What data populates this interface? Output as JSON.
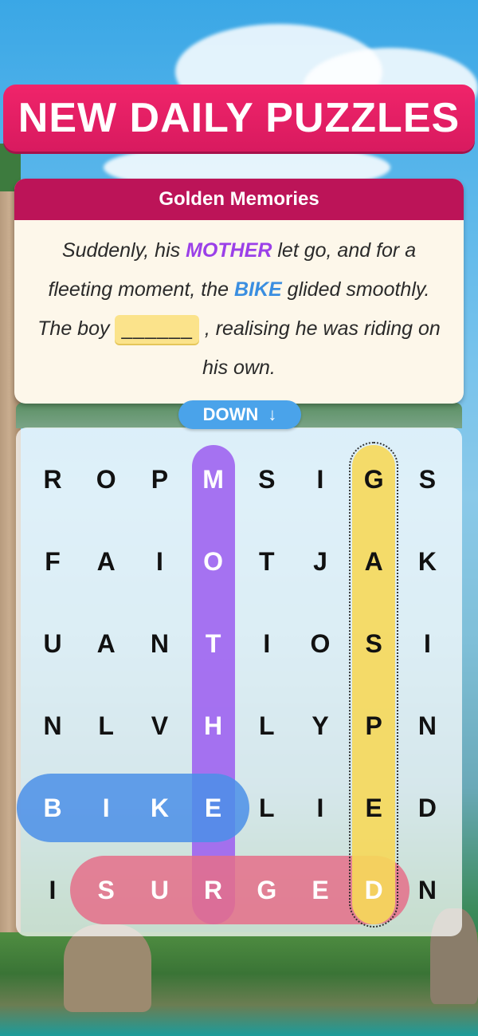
{
  "banner": {
    "title": "NEW DAILY PUZZLES"
  },
  "clue": {
    "title": "Golden Memories",
    "segments": [
      {
        "text": "Suddenly, his ",
        "cls": ""
      },
      {
        "text": "MOTHER",
        "cls": "w-mother"
      },
      {
        "text": " let go, and for a fleeting moment, the ",
        "cls": ""
      },
      {
        "text": "BIKE",
        "cls": "w-bike"
      },
      {
        "text": " glided smoothly. The boy ",
        "cls": ""
      },
      {
        "text": "______",
        "cls": "blank"
      },
      {
        "text": " , realising he was riding on his own.",
        "cls": ""
      }
    ]
  },
  "direction": {
    "label": "DOWN",
    "arrow": "↓"
  },
  "grid": {
    "rows": [
      [
        "R",
        "O",
        "P",
        "M",
        "S",
        "I",
        "G",
        "S"
      ],
      [
        "F",
        "A",
        "I",
        "O",
        "T",
        "J",
        "A",
        "K"
      ],
      [
        "U",
        "A",
        "N",
        "T",
        "I",
        "O",
        "S",
        "I"
      ],
      [
        "N",
        "L",
        "V",
        "H",
        "L",
        "Y",
        "P",
        "N"
      ],
      [
        "B",
        "I",
        "K",
        "E",
        "L",
        "I",
        "E",
        "D"
      ],
      [
        "I",
        "S",
        "U",
        "R",
        "G",
        "E",
        "D",
        "N"
      ]
    ],
    "found_words": [
      {
        "word": "MOTHER",
        "color": "#9b5cf0",
        "start": [
          0,
          3
        ],
        "end": [
          5,
          3
        ]
      },
      {
        "word": "BIKE",
        "color": "#4b8fe8",
        "start": [
          4,
          0
        ],
        "end": [
          4,
          3
        ]
      },
      {
        "word": "SURGED",
        "color": "#e56f8a",
        "start": [
          5,
          1
        ],
        "end": [
          5,
          6
        ]
      },
      {
        "word": "GASPED",
        "color": "#f7d95a",
        "start": [
          0,
          6
        ],
        "end": [
          5,
          6
        ],
        "current": true
      }
    ]
  }
}
